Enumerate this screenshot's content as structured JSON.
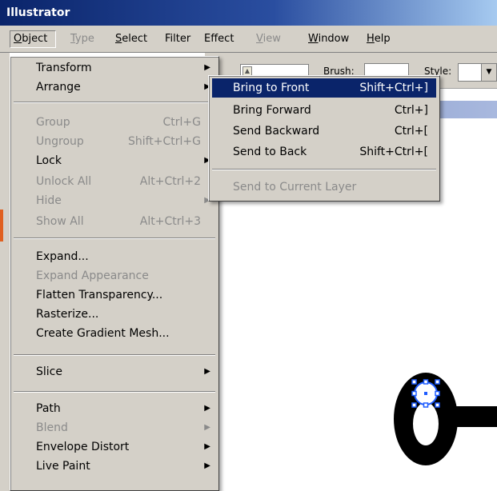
{
  "app": {
    "title": "Illustrator"
  },
  "menubar": [
    {
      "label": "Object",
      "mnemonic": "O",
      "rest": "bject",
      "state": "active"
    },
    {
      "label": "Type",
      "mnemonic": "T",
      "rest": "ype",
      "state": "dim"
    },
    {
      "label": "Select",
      "mnemonic": "S",
      "rest": "elect",
      "state": "normal"
    },
    {
      "label": "Filter",
      "mnemonic": "",
      "rest": "Filter",
      "state": "normal"
    },
    {
      "label": "Effect",
      "mnemonic": "",
      "rest": "Effect",
      "state": "normal"
    },
    {
      "label": "View",
      "mnemonic": "V",
      "rest": "iew",
      "state": "dim"
    },
    {
      "label": "Window",
      "mnemonic": "W",
      "rest": "indow",
      "state": "normal"
    },
    {
      "label": "Help",
      "mnemonic": "H",
      "rest": "elp",
      "state": "normal"
    }
  ],
  "toolbar": {
    "brush_label": "Brush:",
    "style_label": "Style:"
  },
  "object_menu": [
    {
      "label": "Transform",
      "shortcut": "",
      "submenu": true,
      "disabled": false
    },
    {
      "label": "Arrange",
      "shortcut": "",
      "submenu": true,
      "disabled": false
    },
    {
      "label": "Group",
      "shortcut": "Ctrl+G",
      "submenu": false,
      "disabled": true
    },
    {
      "label": "Ungroup",
      "shortcut": "Shift+Ctrl+G",
      "submenu": false,
      "disabled": true
    },
    {
      "label": "Lock",
      "shortcut": "",
      "submenu": true,
      "disabled": false
    },
    {
      "label": "Unlock All",
      "shortcut": "Alt+Ctrl+2",
      "submenu": false,
      "disabled": true
    },
    {
      "label": "Hide",
      "shortcut": "",
      "submenu": true,
      "disabled": true
    },
    {
      "label": "Show All",
      "shortcut": "Alt+Ctrl+3",
      "submenu": false,
      "disabled": true
    },
    {
      "label": "Expand...",
      "shortcut": "",
      "submenu": false,
      "disabled": false
    },
    {
      "label": "Expand Appearance",
      "shortcut": "",
      "submenu": false,
      "disabled": true
    },
    {
      "label": "Flatten Transparency...",
      "shortcut": "",
      "submenu": false,
      "disabled": false
    },
    {
      "label": "Rasterize...",
      "shortcut": "",
      "submenu": false,
      "disabled": false
    },
    {
      "label": "Create Gradient Mesh...",
      "shortcut": "",
      "submenu": false,
      "disabled": false
    },
    {
      "label": "Slice",
      "shortcut": "",
      "submenu": true,
      "disabled": false
    },
    {
      "label": "Path",
      "shortcut": "",
      "submenu": true,
      "disabled": false
    },
    {
      "label": "Blend",
      "shortcut": "",
      "submenu": true,
      "disabled": true
    },
    {
      "label": "Envelope Distort",
      "shortcut": "",
      "submenu": true,
      "disabled": false
    },
    {
      "label": "Live Paint",
      "shortcut": "",
      "submenu": true,
      "disabled": false
    }
  ],
  "arrange_menu": [
    {
      "label": "Bring to Front",
      "shortcut": "Shift+Ctrl+]",
      "selected": true,
      "disabled": false
    },
    {
      "label": "Bring Forward",
      "shortcut": "Ctrl+]",
      "selected": false,
      "disabled": false
    },
    {
      "label": "Send Backward",
      "shortcut": "Ctrl+[",
      "selected": false,
      "disabled": false
    },
    {
      "label": "Send to Back",
      "shortcut": "Shift+Ctrl+[",
      "selected": false,
      "disabled": false
    },
    {
      "label": "Send to Current Layer",
      "shortcut": "",
      "selected": false,
      "disabled": true
    }
  ],
  "colors": {
    "selection": "#0a246a",
    "menu_bg": "#d4d0c8",
    "disabled_text": "#8a8a8a",
    "selection_handles": "#1e5cff"
  }
}
